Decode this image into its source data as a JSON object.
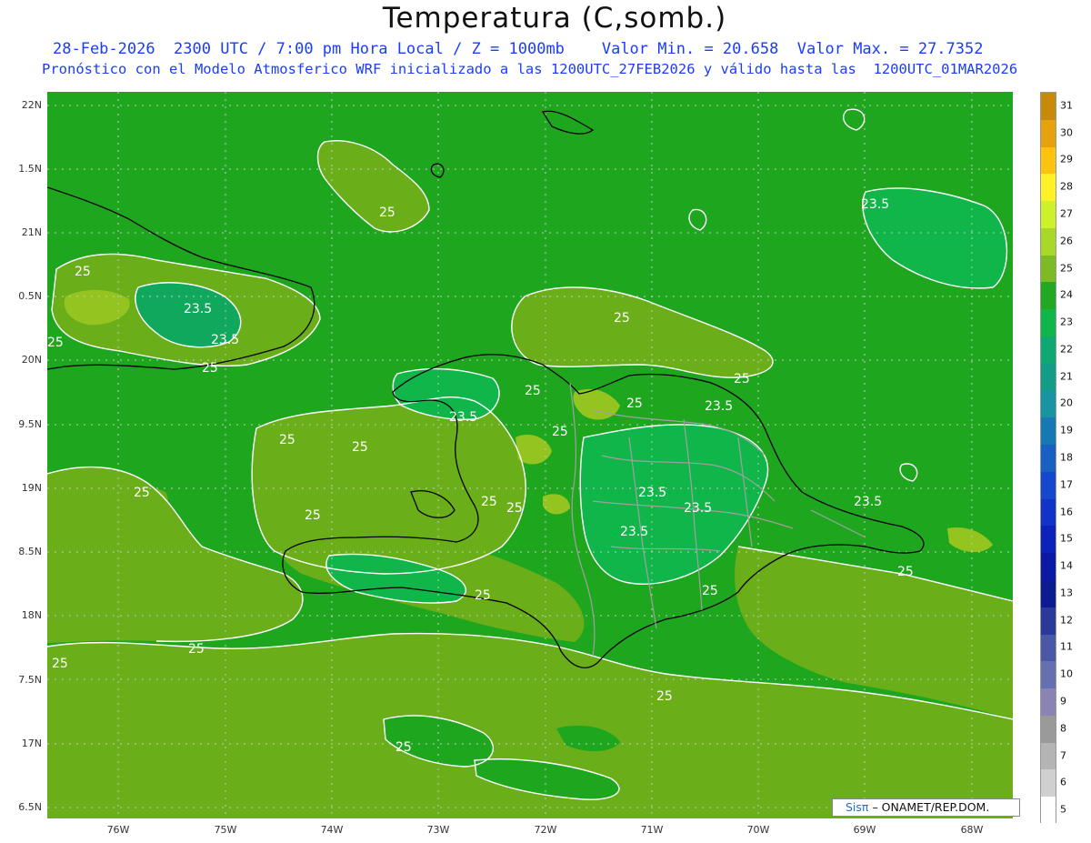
{
  "header": {
    "title": "Temperatura (C,somb.)",
    "subtitle_line1": "28-Feb-2026  2300 UTC / 7:00 pm Hora Local / Z = 1000mb    Valor Min. = 20.658  Valor Max. = 27.7352",
    "subtitle_line2": "Pronóstico con el Modelo Atmosferico WRF inicializado a las 1200UTC_27FEB2026 y válido hasta las  1200UTC_01MAR2026"
  },
  "map": {
    "lat_labels": [
      "22N",
      "1.5N",
      "21N",
      "0.5N",
      "20N",
      "9.5N",
      "19N",
      "8.5N",
      "18N",
      "7.5N",
      "17N",
      "6.5N"
    ],
    "lon_labels": [
      "76W",
      "75W",
      "74W",
      "73W",
      "72W",
      "71W",
      "70W",
      "69W",
      "68W"
    ],
    "contour_labels": [
      "25",
      "25",
      "23.5",
      "23.5",
      "25",
      "25",
      "23.5",
      "25",
      "25",
      "25",
      "25",
      "23.5",
      "25",
      "25",
      "25",
      "23.5",
      "23.5",
      "23.5",
      "23.5",
      "25",
      "25",
      "25",
      "25",
      "25",
      "25",
      "23.5",
      "25",
      "25",
      "25",
      "25",
      "25"
    ],
    "colors": {
      "c22": "#0fa85c",
      "c23": "#22ad1f",
      "c24": "#1fa61f",
      "c25": "#6aae1a",
      "c26": "#94c41f",
      "grid": "#c8c8c8",
      "contour": "#ffffff",
      "coast": "#000000",
      "border": "#a0a0a0"
    }
  },
  "colorbar": {
    "labels": [
      "31",
      "30",
      "29",
      "28",
      "27",
      "26",
      "25",
      "24",
      "23",
      "22",
      "21",
      "20",
      "19",
      "18",
      "17",
      "16",
      "15",
      "14",
      "13",
      "12",
      "11",
      "10",
      "9",
      "8",
      "7",
      "6",
      "5"
    ],
    "colors": [
      "#c88a0a",
      "#e6a10c",
      "#ffc20f",
      "#fff227",
      "#cdf22b",
      "#a9d82a",
      "#7dbb24",
      "#22a822",
      "#11b64a",
      "#0fa873",
      "#129d88",
      "#1894a2",
      "#1877b5",
      "#1860c2",
      "#1548cc",
      "#1133c8",
      "#0d22b8",
      "#0a1aa4",
      "#0c1a94",
      "#2a3a9a",
      "#4a58a8",
      "#6670b0",
      "#8a84b4",
      "#9a9a9a",
      "#b4b4b4",
      "#d0d0d0",
      "#ffffff"
    ]
  },
  "credit": {
    "sis": "Sisπ",
    "rest": "– ONAMET/REP.DOM."
  }
}
